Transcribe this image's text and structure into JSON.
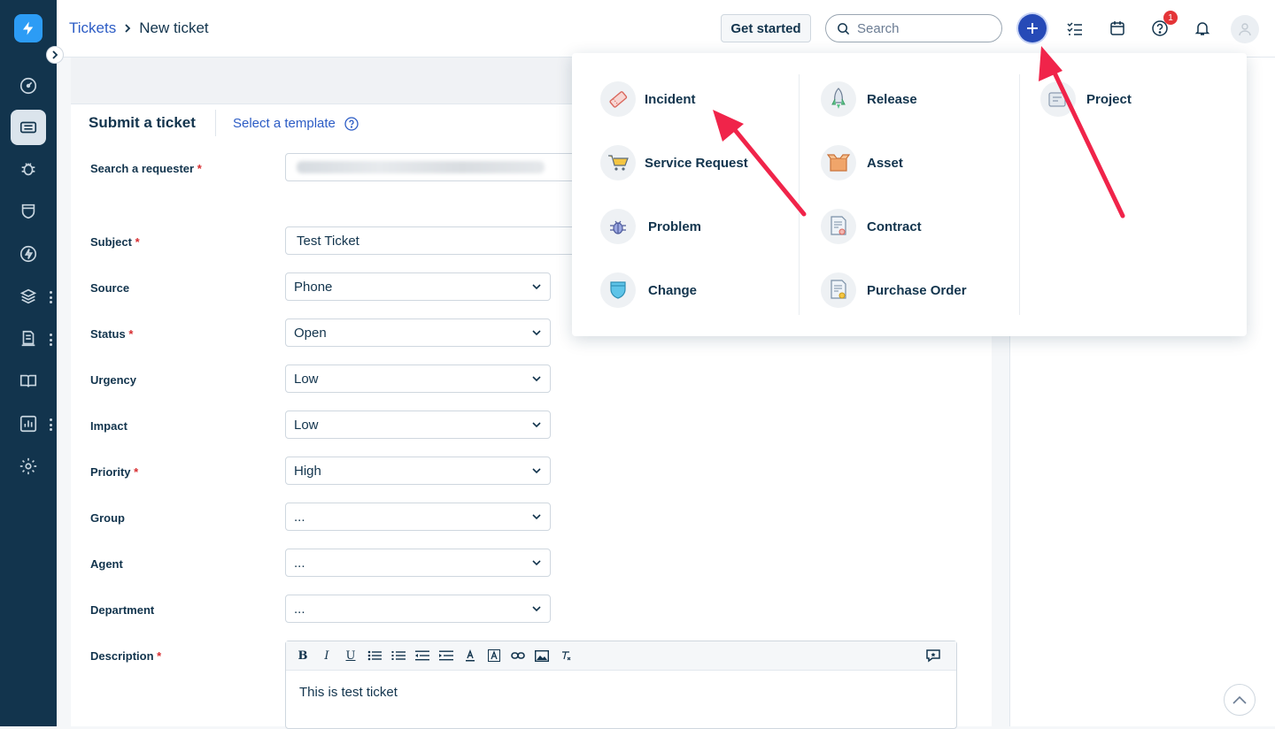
{
  "header": {
    "breadcrumb_parent": "Tickets",
    "breadcrumb_current": "New ticket",
    "get_started_label": "Get started",
    "search_placeholder": "Search",
    "help_badge_count": "1"
  },
  "form": {
    "title": "Submit a ticket",
    "template_link": "Select a template",
    "fields": {
      "requester": {
        "label": "Search a requester"
      },
      "subject": {
        "label": "Subject",
        "value": "Test Ticket"
      },
      "source": {
        "label": "Source",
        "value": "Phone"
      },
      "status": {
        "label": "Status",
        "value": "Open"
      },
      "urgency": {
        "label": "Urgency",
        "value": "Low"
      },
      "impact": {
        "label": "Impact",
        "value": "Low"
      },
      "priority": {
        "label": "Priority",
        "value": "High"
      },
      "group": {
        "label": "Group",
        "value": "..."
      },
      "agent": {
        "label": "Agent",
        "value": "..."
      },
      "department": {
        "label": "Department",
        "value": "..."
      },
      "description": {
        "label": "Description",
        "value": "This is test ticket"
      }
    },
    "required_mark": "*"
  },
  "new_menu": {
    "items": [
      {
        "label": "Incident",
        "icon": "ticket-icon"
      },
      {
        "label": "Service Request",
        "icon": "cart-icon"
      },
      {
        "label": "Problem",
        "icon": "bug-icon"
      },
      {
        "label": "Change",
        "icon": "shield-icon"
      },
      {
        "label": "Release",
        "icon": "rocket-icon"
      },
      {
        "label": "Asset",
        "icon": "box-icon"
      },
      {
        "label": "Contract",
        "icon": "certificate-icon"
      },
      {
        "label": "Purchase Order",
        "icon": "invoice-icon"
      },
      {
        "label": "Project",
        "icon": "project-icon"
      }
    ]
  },
  "colors": {
    "sidebar": "#12344d",
    "accent": "#264ab7",
    "link": "#2c5cc5",
    "annotation_arrow": "#f0244a",
    "required": "#d72d30"
  }
}
